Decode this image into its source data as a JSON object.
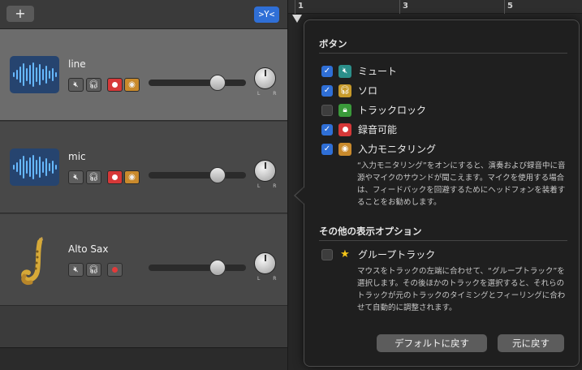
{
  "toolbar": {
    "add_label": "+",
    "filter_label": ">Y<"
  },
  "ruler": {
    "ticks": [
      "1",
      "3",
      "5"
    ]
  },
  "tracks": [
    {
      "name": "line"
    },
    {
      "name": "mic"
    },
    {
      "name": "Alto Sax"
    }
  ],
  "track_knob_lr": "L R",
  "popover": {
    "buttons_section": {
      "title": "ボタン",
      "items": [
        {
          "label": "ミュート",
          "checked": true
        },
        {
          "label": "ソロ",
          "checked": true
        },
        {
          "label": "トラックロック",
          "checked": false
        },
        {
          "label": "録音可能",
          "checked": true
        },
        {
          "label": "入力モニタリング",
          "checked": true
        }
      ],
      "description": "“入力モニタリング”をオンにすると、演奏および録音中に音源やマイクのサウンドが聞こえます。マイクを使用する場合は、フィードバックを回避するためにヘッドフォンを装着することをお勧めします。"
    },
    "other_section": {
      "title": "その他の表示オプション",
      "group_track": {
        "label": "グループトラック",
        "checked": false
      },
      "description": "マウスをトラックの左端に合わせて、“グループトラック”を選択します。その後ほかのトラックを選択すると、それらのトラックが元のトラックのタイミングとフィーリングに合わせて自動的に調整されます。"
    },
    "default_button": "デフォルトに戻す",
    "revert_button": "元に戻す"
  },
  "colors": {
    "accent_blue": "#2f6fd6",
    "mute_teal": "#2b8f8a",
    "solo_gold": "#c79a2a",
    "lock_green": "#3a9a3a",
    "record_red": "#d63838",
    "monitor_orange": "#c98a2c",
    "star_yellow": "#f5c518"
  }
}
